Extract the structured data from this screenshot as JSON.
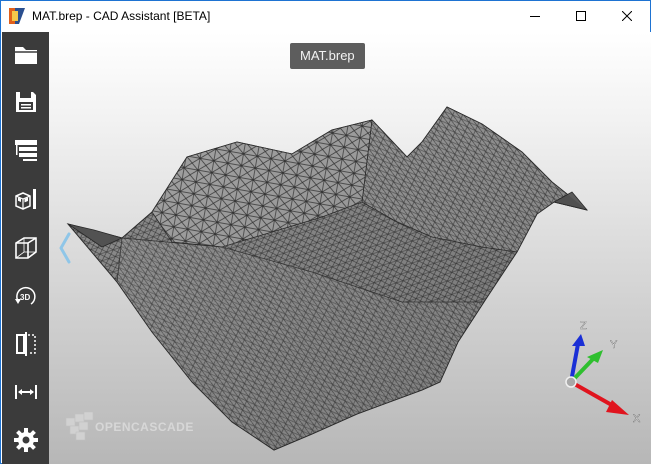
{
  "window": {
    "title": "MAT.brep - CAD Assistant [BETA]"
  },
  "viewport": {
    "document_label": "MAT.brep"
  },
  "sidebar": {
    "items": [
      {
        "icon": "folder-icon"
      },
      {
        "icon": "save-icon"
      },
      {
        "icon": "model-tree-icon"
      },
      {
        "icon": "shaded-view-icon"
      },
      {
        "icon": "wireframe-cube-icon"
      },
      {
        "icon": "rotate-3d-icon"
      },
      {
        "icon": "section-clip-icon"
      },
      {
        "icon": "measure-icon"
      },
      {
        "icon": "settings-gear-icon"
      }
    ]
  },
  "watermark": {
    "text": "OPENCASCADE"
  },
  "axes": {
    "x": "X",
    "y": "Y",
    "z": "Z"
  },
  "colors": {
    "axis_x": "#e0141e",
    "axis_y": "#2fbf2f",
    "axis_z": "#1a2fd6",
    "sidebar": "#3b3b3b",
    "accent": "#1e73d2"
  }
}
